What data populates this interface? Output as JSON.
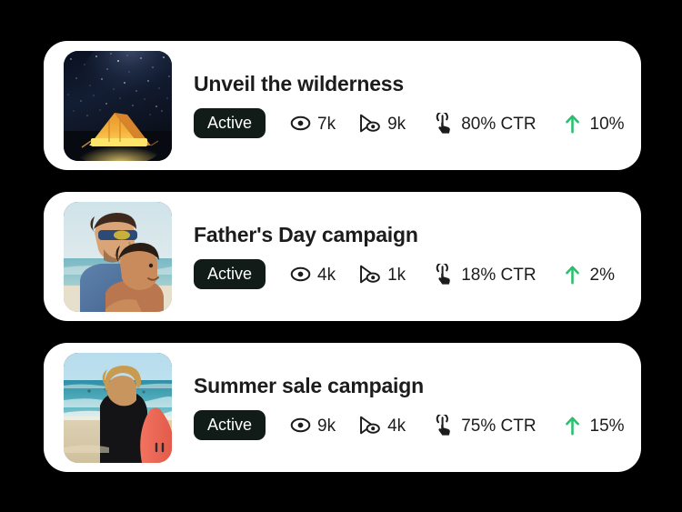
{
  "theme": {
    "background": "#000000",
    "card_background": "#ffffff",
    "text_color": "#1c1c1c",
    "badge_background": "#111c18",
    "badge_text": "#ffffff",
    "trend_up_color": "#29c06d"
  },
  "campaigns": [
    {
      "title": "Unveil the wilderness",
      "status": "Active",
      "thumbnail": "night-sky-tent-photo",
      "metrics": {
        "impressions": "7k",
        "video_views": "9k",
        "ctr": "80% CTR",
        "trend": "10%"
      },
      "icons": {
        "impressions": "eye-icon",
        "video_views": "video-view-icon",
        "ctr": "tap-click-icon",
        "trend": "arrow-up-icon"
      }
    },
    {
      "title": "Father's Day campaign",
      "status": "Active",
      "thumbnail": "father-and-son-beach-photo",
      "metrics": {
        "impressions": "4k",
        "video_views": "1k",
        "ctr": "18% CTR",
        "trend": "2%"
      },
      "icons": {
        "impressions": "eye-icon",
        "video_views": "video-view-icon",
        "ctr": "tap-click-icon",
        "trend": "arrow-up-icon"
      }
    },
    {
      "title": "Summer sale campaign",
      "status": "Active",
      "thumbnail": "surfer-with-surfboard-beach-photo",
      "metrics": {
        "impressions": "9k",
        "video_views": "4k",
        "ctr": "75% CTR",
        "trend": "15%"
      },
      "icons": {
        "impressions": "eye-icon",
        "video_views": "video-view-icon",
        "ctr": "tap-click-icon",
        "trend": "arrow-up-icon"
      }
    }
  ]
}
